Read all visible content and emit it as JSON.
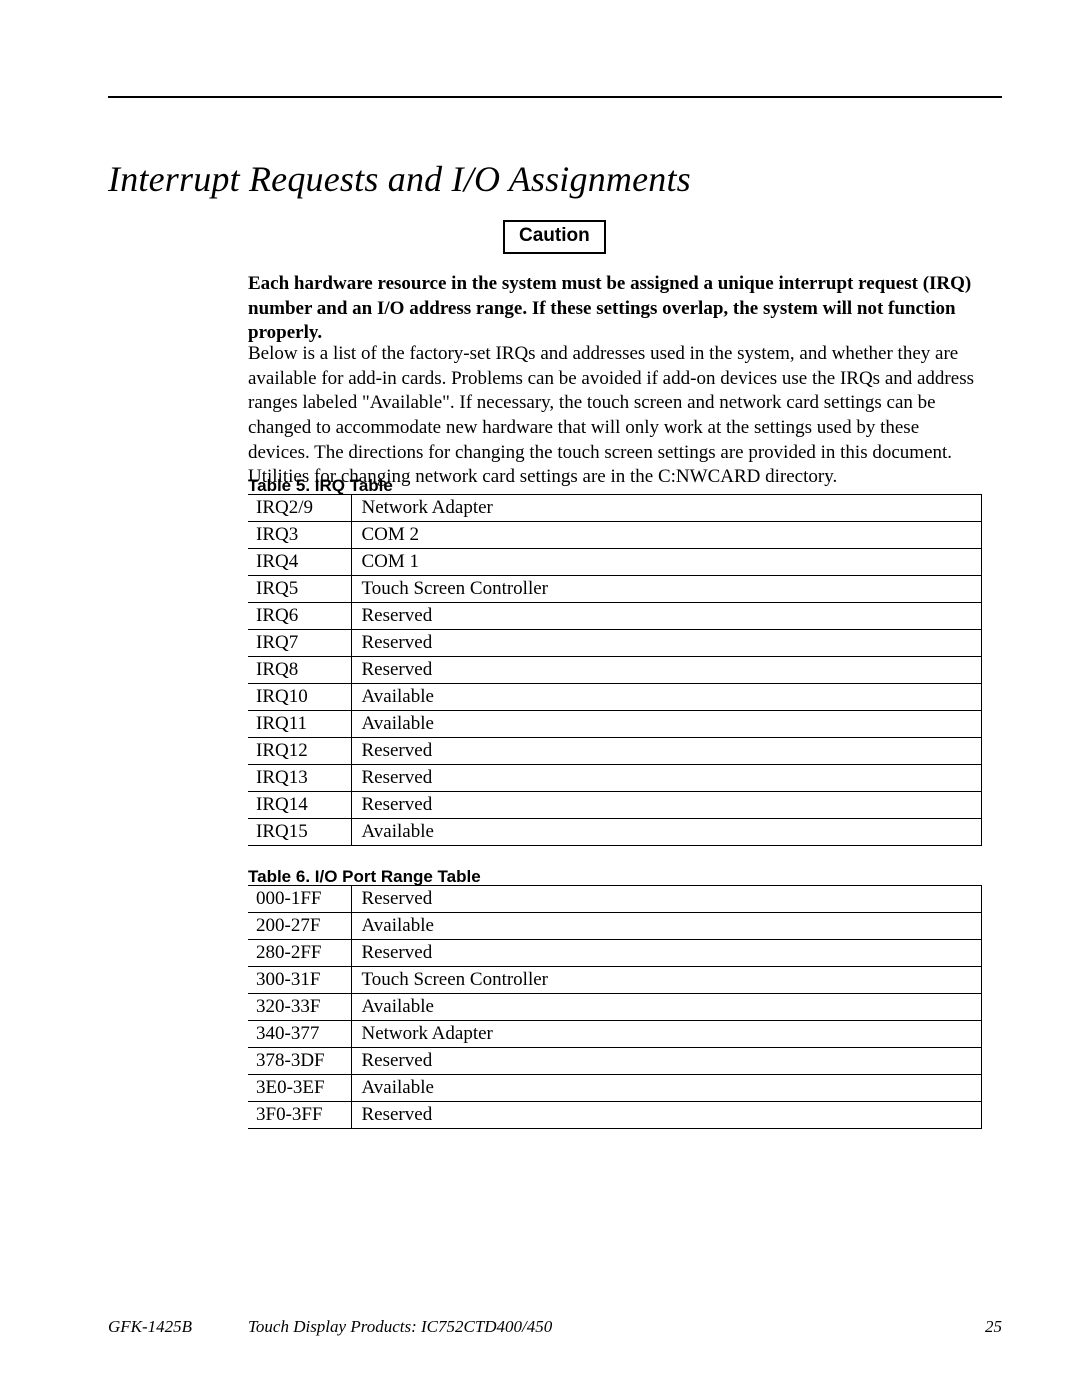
{
  "heading": "Interrupt Requests and I/O Assignments",
  "caution_label": "Caution",
  "caution_text": "Each hardware resource in the system must be assigned a unique interrupt request (IRQ) number and an I/O address range. If these settings overlap, the system will not function properly.",
  "intro_text": "Below is a list of the factory-set IRQs and addresses used in the system, and whether they are available for add-in cards. Problems can be avoided if add-on devices use the IRQs and address ranges labeled \"Available\". If necessary, the touch screen and network card settings can be changed to accommodate new hardware that will only work at the settings used by these devices. The directions for changing the touch screen settings are provided in this document. Utilities for changing network card settings are in the C:NWCARD directory.",
  "table1": {
    "title": "Table 5. IRQ Table",
    "rows": [
      {
        "irq": "IRQ2/9",
        "assign": "Network Adapter"
      },
      {
        "irq": "IRQ3",
        "assign": "COM 2"
      },
      {
        "irq": "IRQ4",
        "assign": "COM 1"
      },
      {
        "irq": "IRQ5",
        "assign": "Touch Screen Controller"
      },
      {
        "irq": "IRQ6",
        "assign": "Reserved"
      },
      {
        "irq": "IRQ7",
        "assign": "Reserved"
      },
      {
        "irq": "IRQ8",
        "assign": "Reserved"
      },
      {
        "irq": "IRQ10",
        "assign": "Available"
      },
      {
        "irq": "IRQ11",
        "assign": "Available"
      },
      {
        "irq": "IRQ12",
        "assign": "Reserved"
      },
      {
        "irq": "IRQ13",
        "assign": "Reserved"
      },
      {
        "irq": "IRQ14",
        "assign": "Reserved"
      },
      {
        "irq": "IRQ15",
        "assign": "Available"
      }
    ]
  },
  "table2": {
    "title": "Table 6.  I/O Port Range Table",
    "rows": [
      {
        "range": "000-1FF",
        "assign": "Reserved"
      },
      {
        "range": "200-27F",
        "assign": "Available"
      },
      {
        "range": "280-2FF",
        "assign": "Reserved"
      },
      {
        "range": "300-31F",
        "assign": "Touch Screen Controller"
      },
      {
        "range": "320-33F",
        "assign": "Available"
      },
      {
        "range": "340-377",
        "assign": "Network Adapter"
      },
      {
        "range": "378-3DF",
        "assign": "Reserved"
      },
      {
        "range": "3E0-3EF",
        "assign": "Available"
      },
      {
        "range": "3F0-3FF",
        "assign": "Reserved"
      }
    ]
  },
  "footer": {
    "doc_id": "GFK-1425B",
    "title": "Touch Display Products: IC752CTD400/450",
    "page": "25"
  }
}
